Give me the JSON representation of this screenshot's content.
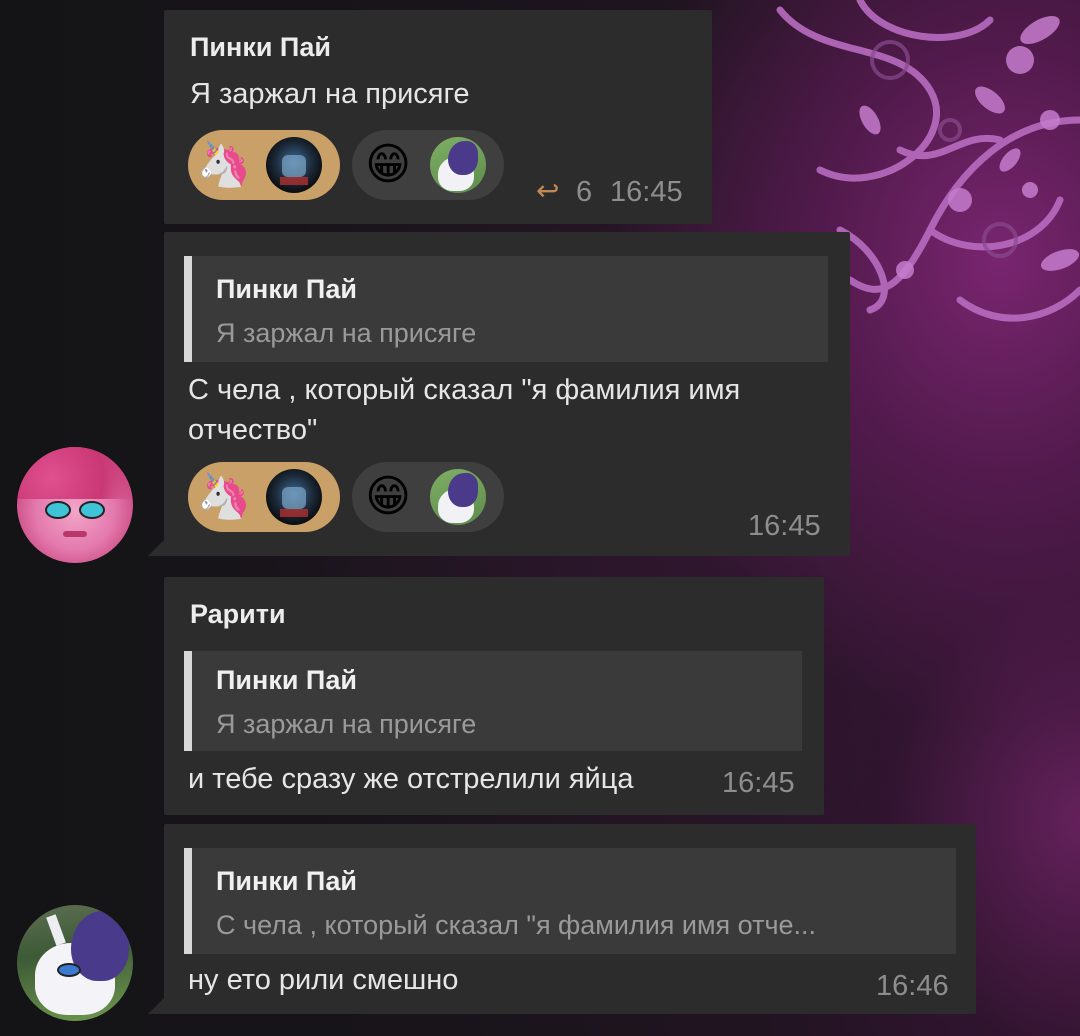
{
  "messages": [
    {
      "sender": "Пинки Пай",
      "text": "Я заржал на присяге",
      "reactions": [
        {
          "emoji": "🦄",
          "avatar": "dark-mask-avatar",
          "active": true
        },
        {
          "emoji": "😁",
          "avatar": "rarity-avatar",
          "active": false
        }
      ],
      "forward_icon": "↩",
      "forward_count": "6",
      "time": "16:45"
    },
    {
      "reply_to": {
        "name": "Пинки Пай",
        "text": "Я заржал на присяге"
      },
      "text_line1": "С чела , который сказал \"я фамилия имя",
      "text_line2": "отчество\"",
      "reactions": [
        {
          "emoji": "🦄",
          "avatar": "dark-mask-avatar",
          "active": true
        },
        {
          "emoji": "😁",
          "avatar": "rarity-avatar",
          "active": false
        }
      ],
      "time": "16:45"
    },
    {
      "sender": "Рарити",
      "reply_to": {
        "name": "Пинки Пай",
        "text": "Я заржал на присяге"
      },
      "text": "и тебе сразу же отстрелили яйца",
      "time": "16:45"
    },
    {
      "reply_to": {
        "name": "Пинки Пай",
        "text": "С чела , который сказал \"я фамилия имя отче..."
      },
      "text": "ну ето рили смешно",
      "time": "16:46"
    }
  ],
  "avatars": {
    "pinkie": "pinkie-pie-avatar",
    "rarity": "rarity-avatar"
  },
  "colors": {
    "bubble": "#2c2c2d",
    "reply_bg": "#3a3a3b",
    "active_reaction": "#c9a067",
    "time": "#8e8e8e"
  }
}
